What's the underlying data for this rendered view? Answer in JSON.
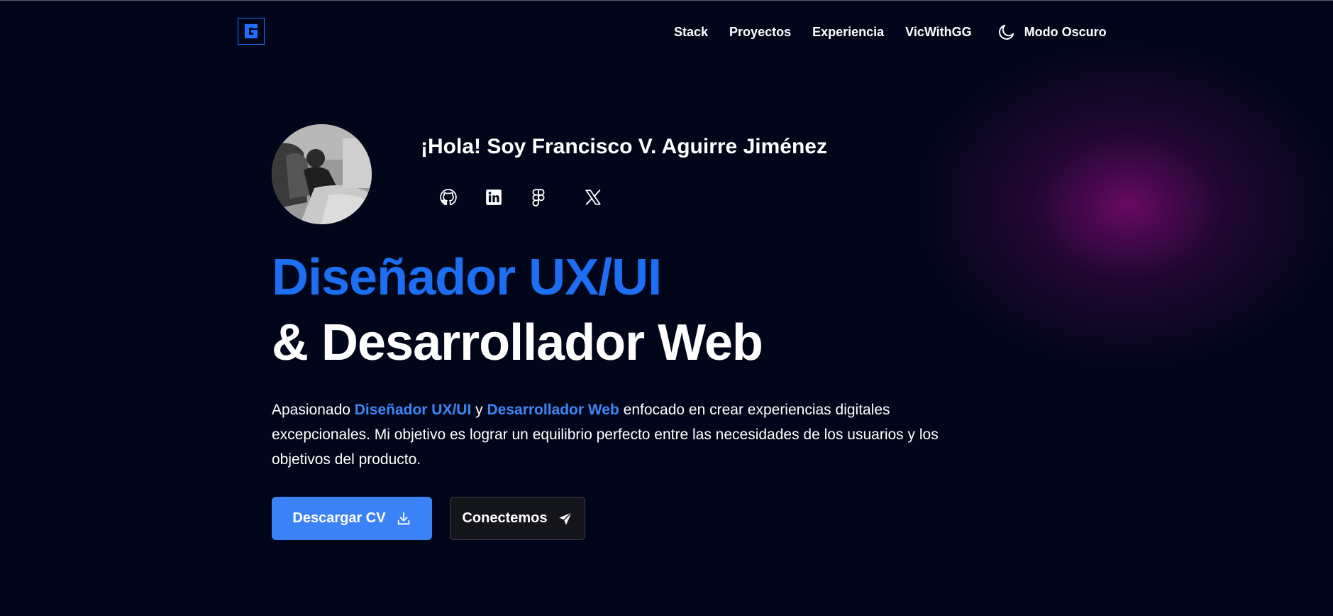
{
  "nav": {
    "logo_letter": "G",
    "links": [
      "Stack",
      "Proyectos",
      "Experiencia",
      "VicWithGG"
    ],
    "theme_toggle_label": "Modo Oscuro"
  },
  "hero": {
    "greeting": "¡Hola! Soy Francisco V. Aguirre Jiménez",
    "socials": [
      "github-icon",
      "linkedin-icon",
      "figma-icon",
      "x-icon"
    ],
    "headline_line1": "Diseñador UX/UI",
    "headline_line2": "& Desarrollador Web",
    "description": {
      "part1": "Apasionado ",
      "highlight1": "Diseñador UX/UI",
      "part2": " y ",
      "highlight2": "Desarrollador Web",
      "part3": " enfocado en crear experiencias digitales excepcionales. Mi objetivo es lograr un equilibrio perfecto entre las necesidades de los usuarios y los objetivos del producto."
    },
    "buttons": {
      "download_cv": "Descargar CV",
      "connect": "Conectemos"
    }
  },
  "colors": {
    "background": "#02061a",
    "accent_blue": "#1c6ef2",
    "button_blue": "#3b82f6",
    "glow_magenta": "#780a6e"
  }
}
